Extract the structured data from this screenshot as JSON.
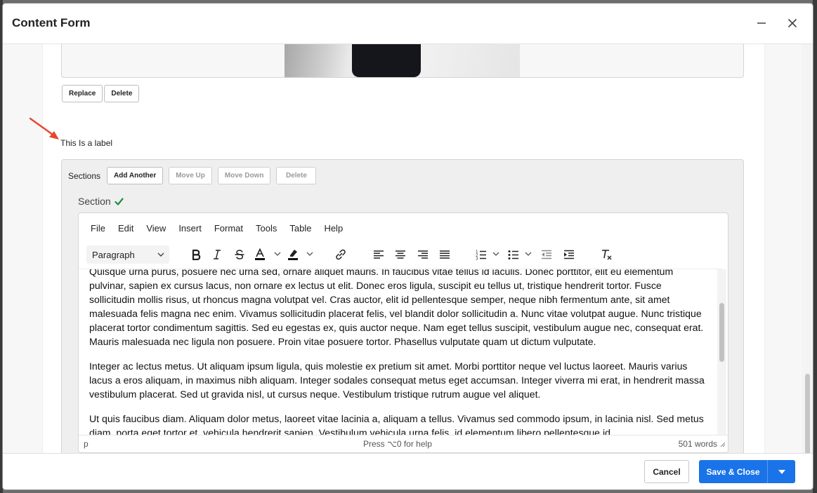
{
  "modal": {
    "title": "Content Form",
    "minimize_icon": "minus-icon",
    "close_icon": "close-icon"
  },
  "image_field": {
    "replace_label": "Replace",
    "delete_label": "Delete"
  },
  "field_label": "This Is a label",
  "sections": {
    "title": "Sections",
    "add_another_label": "Add Another",
    "move_up_label": "Move Up",
    "move_down_label": "Move Down",
    "delete_label": "Delete",
    "section_label": "Section",
    "section_status_icon": "checkmark-icon",
    "section_status_color": "#1e8e3e"
  },
  "editor": {
    "menu": [
      "File",
      "Edit",
      "View",
      "Insert",
      "Format",
      "Tools",
      "Table",
      "Help"
    ],
    "block_format": "Paragraph",
    "paragraphs": [
      "Quisque urna purus, posuere nec urna sed, ornare aliquet mauris. In faucibus vitae tellus id iaculis. Donec porttitor, elit eu elementum pulvinar, sapien ex cursus lacus, non ornare ex lectus ut elit. Donec eros ligula, suscipit eu tellus ut, tristique hendrerit tortor. Fusce sollicitudin mollis risus, ut rhoncus magna volutpat vel. Cras auctor, elit id pellentesque semper, neque nibh fermentum ante, sit amet malesuada felis magna nec enim. Vivamus sollicitudin placerat felis, vel blandit dolor sollicitudin a. Nunc vitae volutpat augue. Nunc tristique placerat tortor condimentum sagittis. Sed eu egestas ex, quis auctor neque. Nam eget tellus suscipit, vestibulum augue nec, consequat erat. Mauris malesuada nec ligula non posuere. Proin vitae posuere tortor. Phasellus vulputate quam ut dictum vulputate.",
      "Integer ac lectus metus. Ut aliquam ipsum ligula, quis molestie ex pretium sit amet. Morbi porttitor neque vel luctus laoreet. Mauris varius lacus a eros aliquam, in maximus nibh aliquam. Integer sodales consequat metus eget accumsan. Integer viverra mi erat, in hendrerit massa vestibulum placerat. Sed ut gravida nisl, ut cursus neque. Vestibulum tristique rutrum augue vel aliquet.",
      "Ut quis faucibus diam. Aliquam dolor metus, laoreet vitae lacinia a, aliquam a tellus. Vivamus sed commodo ipsum, in lacinia nisl. Sed metus diam, porta eget tortor et, vehicula hendrerit sapien. Vestibulum vehicula urna felis, id elementum libero pellentesque id."
    ],
    "status_path": "p",
    "status_help": "Press ⌥0 for help",
    "status_words": "501 words"
  },
  "footer": {
    "cancel_label": "Cancel",
    "save_label": "Save & Close",
    "save_color": "#1a73e8"
  },
  "annotation": {
    "arrow_color": "#e8452c"
  }
}
